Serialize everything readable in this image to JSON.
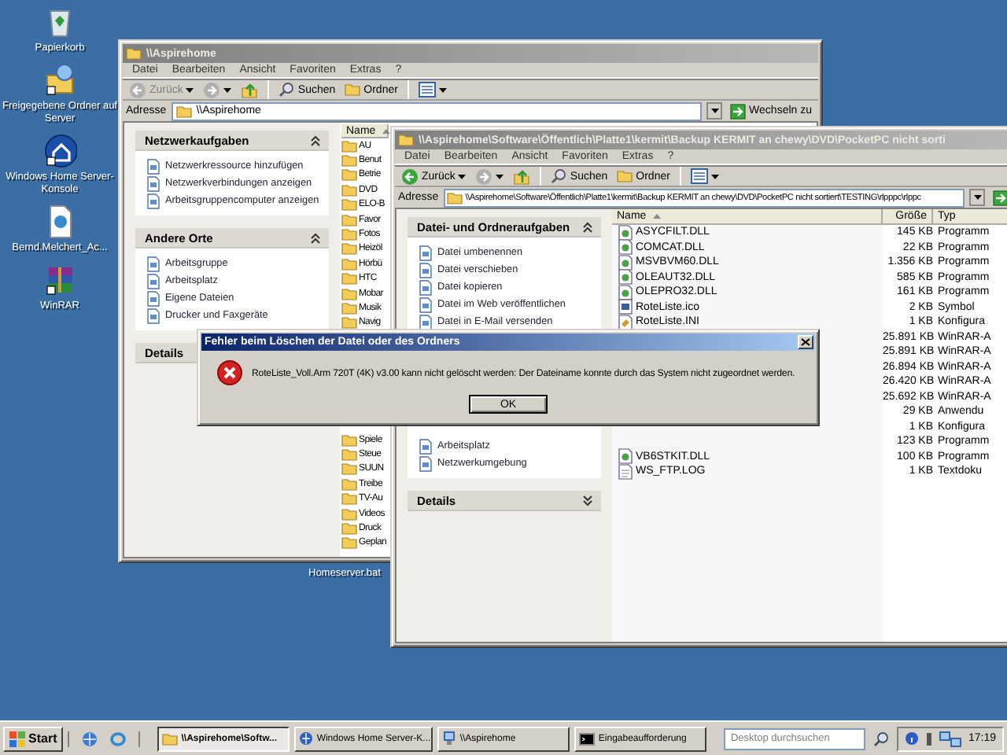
{
  "desktop_icons": [
    {
      "label": "Papierkorb",
      "kind": "bin"
    },
    {
      "label": "Freigegebene Ordner auf Server",
      "kind": "share"
    },
    {
      "label": "Windows Home Server-Konsole",
      "kind": "home"
    },
    {
      "label": "Bernd.Melchert_Ac...",
      "kind": "doc"
    },
    {
      "label": "WinRAR",
      "kind": "rar"
    }
  ],
  "desktop_file": {
    "label": "Homeserver.bat"
  },
  "back_window": {
    "title": "\\\\Aspirehome",
    "menu": [
      "Datei",
      "Bearbeiten",
      "Ansicht",
      "Favoriten",
      "Extras",
      "?"
    ],
    "toolbar": {
      "back": "Zurück",
      "back_enabled": false,
      "search": "Suchen",
      "folders": "Ordner"
    },
    "address_label": "Adresse",
    "address": "\\\\Aspirehome",
    "go": "Wechseln zu",
    "panels": [
      {
        "title": "Netzwerkaufgaben",
        "expanded": true,
        "items": [
          "Netzwerkressource hinzufügen",
          "Netzwerkverbindungen anzeigen",
          "Arbeitsgruppencomputer anzeigen"
        ]
      },
      {
        "title": "Andere Orte",
        "expanded": true,
        "items": [
          "Arbeitsgruppe",
          "Arbeitsplatz",
          "Eigene Dateien",
          "Drucker und Faxgeräte"
        ]
      },
      {
        "title": "Details",
        "expanded": false
      }
    ],
    "column": "Name",
    "folders_top": [
      "AU",
      "Benut",
      "Betrie",
      "DVD",
      "ELO-B",
      "Favor",
      "Fotos",
      "Heizöl",
      "Hörbü",
      "HTC",
      "Mobar",
      "Musik",
      "Navig"
    ],
    "folders_bottom": [
      "Spiele",
      "Steue",
      "SUUN",
      "Treibe",
      "TV-Au",
      "Videos",
      "Druck",
      "Geplan"
    ]
  },
  "front_window": {
    "title": "\\\\Aspirehome\\Software\\Öffentlich\\Platte1\\kermit\\Backup KERMIT an chewy\\DVD\\PocketPC nicht sorti",
    "menu": [
      "Datei",
      "Bearbeiten",
      "Ansicht",
      "Favoriten",
      "Extras",
      "?"
    ],
    "toolbar": {
      "back": "Zurück",
      "back_enabled": true,
      "search": "Suchen",
      "folders": "Ordner"
    },
    "address_label": "Adresse",
    "address": "\\\\Aspirehome\\Software\\Öffentlich\\Platte1\\kermit\\Backup KERMIT an chewy\\DVD\\PocketPC nicht sortiert\\TESTING\\rlpppc\\rlppc",
    "panels": [
      {
        "title": "Datei- und Ordneraufgaben",
        "expanded": true,
        "items": [
          "Datei umbenennen",
          "Datei verschieben",
          "Datei kopieren",
          "Datei im Web veröffentlichen",
          "Datei in E-Mail versenden"
        ]
      },
      {
        "items": [
          "Arbeitsplatz",
          "Netzwerkumgebung"
        ]
      },
      {
        "title": "Details",
        "expanded": false
      }
    ],
    "columns": [
      "Name",
      "Größe",
      "Typ"
    ],
    "rows": [
      {
        "name": "ASYCFILT.DLL",
        "size": "145 KB",
        "type": "Programm",
        "kind": "program"
      },
      {
        "name": "COMCAT.DLL",
        "size": "22 KB",
        "type": "Programm",
        "kind": "program"
      },
      {
        "name": "MSVBVM60.DLL",
        "size": "1.356 KB",
        "type": "Programm",
        "kind": "program"
      },
      {
        "name": "OLEAUT32.DLL",
        "size": "585 KB",
        "type": "Programm",
        "kind": "program"
      },
      {
        "name": "OLEPRO32.DLL",
        "size": "161 KB",
        "type": "Programm",
        "kind": "program"
      },
      {
        "name": "RoteListe.ico",
        "size": "2 KB",
        "type": "Symbol",
        "kind": "icon"
      },
      {
        "name": "RoteListe.INI",
        "size": "1 KB",
        "type": "Konfigura",
        "kind": "config"
      },
      {
        "size": "25.891 KB",
        "type": "WinRAR-A"
      },
      {
        "size": "25.891 KB",
        "type": "WinRAR-A"
      },
      {
        "size": "26.894 KB",
        "type": "WinRAR-A"
      },
      {
        "size": "26.420 KB",
        "type": "WinRAR-A"
      },
      {
        "size": "25.692 KB",
        "type": "WinRAR-A"
      },
      {
        "size": "29 KB",
        "type": "Anwendu"
      },
      {
        "size": "1 KB",
        "type": "Konfigura"
      },
      {
        "size": "123 KB",
        "type": "Programm"
      },
      {
        "name": "VB6STKIT.DLL",
        "size": "100 KB",
        "type": "Programm",
        "kind": "program"
      },
      {
        "name": "WS_FTP.LOG",
        "size": "1 KB",
        "type": "Textdoku",
        "kind": "text"
      }
    ]
  },
  "dialog": {
    "title": "Fehler beim Löschen der Datei oder des Ordners",
    "message": "RoteListe_Voll.Arm 720T (4K) v3.00 kann nicht gelöscht werden: Der Dateiname konnte durch das System nicht zugeordnet werden.",
    "button": "OK"
  },
  "taskbar": {
    "start": "Start",
    "tasks": [
      {
        "label": "\\\\Aspirehome\\Softw...",
        "selected": true,
        "kind": "folder"
      },
      {
        "label": "Windows Home Server-K...",
        "selected": false,
        "kind": "app"
      },
      {
        "label": "\\\\Aspirehome",
        "selected": false,
        "kind": "network"
      },
      {
        "label": "Eingabeaufforderung",
        "selected": false,
        "kind": "console"
      }
    ],
    "search_placeholder": "Desktop durchsuchen",
    "clock": "17:19"
  }
}
